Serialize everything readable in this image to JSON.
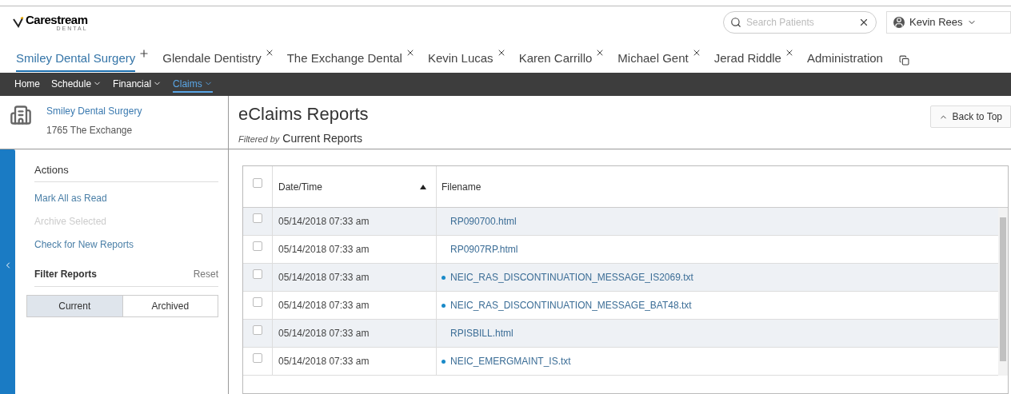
{
  "brand": {
    "name": "Carestream",
    "sub": "DENTAL"
  },
  "search": {
    "placeholder": "Search Patients"
  },
  "user": {
    "name": "Kevin Rees"
  },
  "tabs": [
    {
      "label": "Smiley Dental Surgery",
      "selected": true,
      "kind": "add"
    },
    {
      "label": "Glendale Dentistry",
      "selected": false,
      "kind": "close"
    },
    {
      "label": "The Exchange Dental",
      "selected": false,
      "kind": "close"
    },
    {
      "label": "Kevin Lucas",
      "selected": false,
      "kind": "close"
    },
    {
      "label": "Karen Carrillo",
      "selected": false,
      "kind": "close"
    },
    {
      "label": "Michael Gent",
      "selected": false,
      "kind": "close"
    },
    {
      "label": "Jerad Riddle",
      "selected": false,
      "kind": "close"
    },
    {
      "label": "Administration",
      "selected": false,
      "kind": "plain"
    }
  ],
  "menu": [
    {
      "label": "Home",
      "selected": false,
      "dropdown": false
    },
    {
      "label": "Schedule",
      "selected": false,
      "dropdown": true
    },
    {
      "label": "Financial",
      "selected": false,
      "dropdown": true
    },
    {
      "label": "Claims",
      "selected": true,
      "dropdown": true
    }
  ],
  "practice": {
    "name": "Smiley Dental Surgery",
    "address": "1765 The Exchange"
  },
  "actions": {
    "title": "Actions",
    "items": [
      {
        "label": "Mark All as Read",
        "disabled": false
      },
      {
        "label": "Archive Selected",
        "disabled": true
      },
      {
        "label": "Check for New Reports",
        "disabled": false
      }
    ]
  },
  "filter": {
    "title": "Filter Reports",
    "reset": "Reset",
    "options": [
      {
        "label": "Current",
        "selected": true
      },
      {
        "label": "Archived",
        "selected": false
      }
    ]
  },
  "page": {
    "title": "eClaims Reports",
    "filter_prefix": "Filtered by",
    "filter_value": "Current Reports",
    "back_to_top": "Back to Top"
  },
  "table": {
    "select_all": {
      "checked": false
    },
    "columns": [
      {
        "label": "Date/Time",
        "sorted": true
      },
      {
        "label": "Filename"
      }
    ],
    "rows": [
      {
        "checked": false,
        "date": "05/14/2018 07:33 am",
        "filename": "RP090700.html",
        "unread": false
      },
      {
        "checked": false,
        "date": "05/14/2018 07:33 am",
        "filename": "RP0907RP.html",
        "unread": false
      },
      {
        "checked": false,
        "date": "05/14/2018 07:33 am",
        "filename": "NEIC_RAS_DISCONTINUATION_MESSAGE_IS2069.txt",
        "unread": true
      },
      {
        "checked": false,
        "date": "05/14/2018 07:33 am",
        "filename": "NEIC_RAS_DISCONTINUATION_MESSAGE_BAT48.txt",
        "unread": true
      },
      {
        "checked": false,
        "date": "05/14/2018 07:33 am",
        "filename": "RPISBILL.html",
        "unread": false
      },
      {
        "checked": false,
        "date": "05/14/2018 07:33 am",
        "filename": "NEIC_EMERGMAINT_IS.txt",
        "unread": true
      }
    ]
  }
}
